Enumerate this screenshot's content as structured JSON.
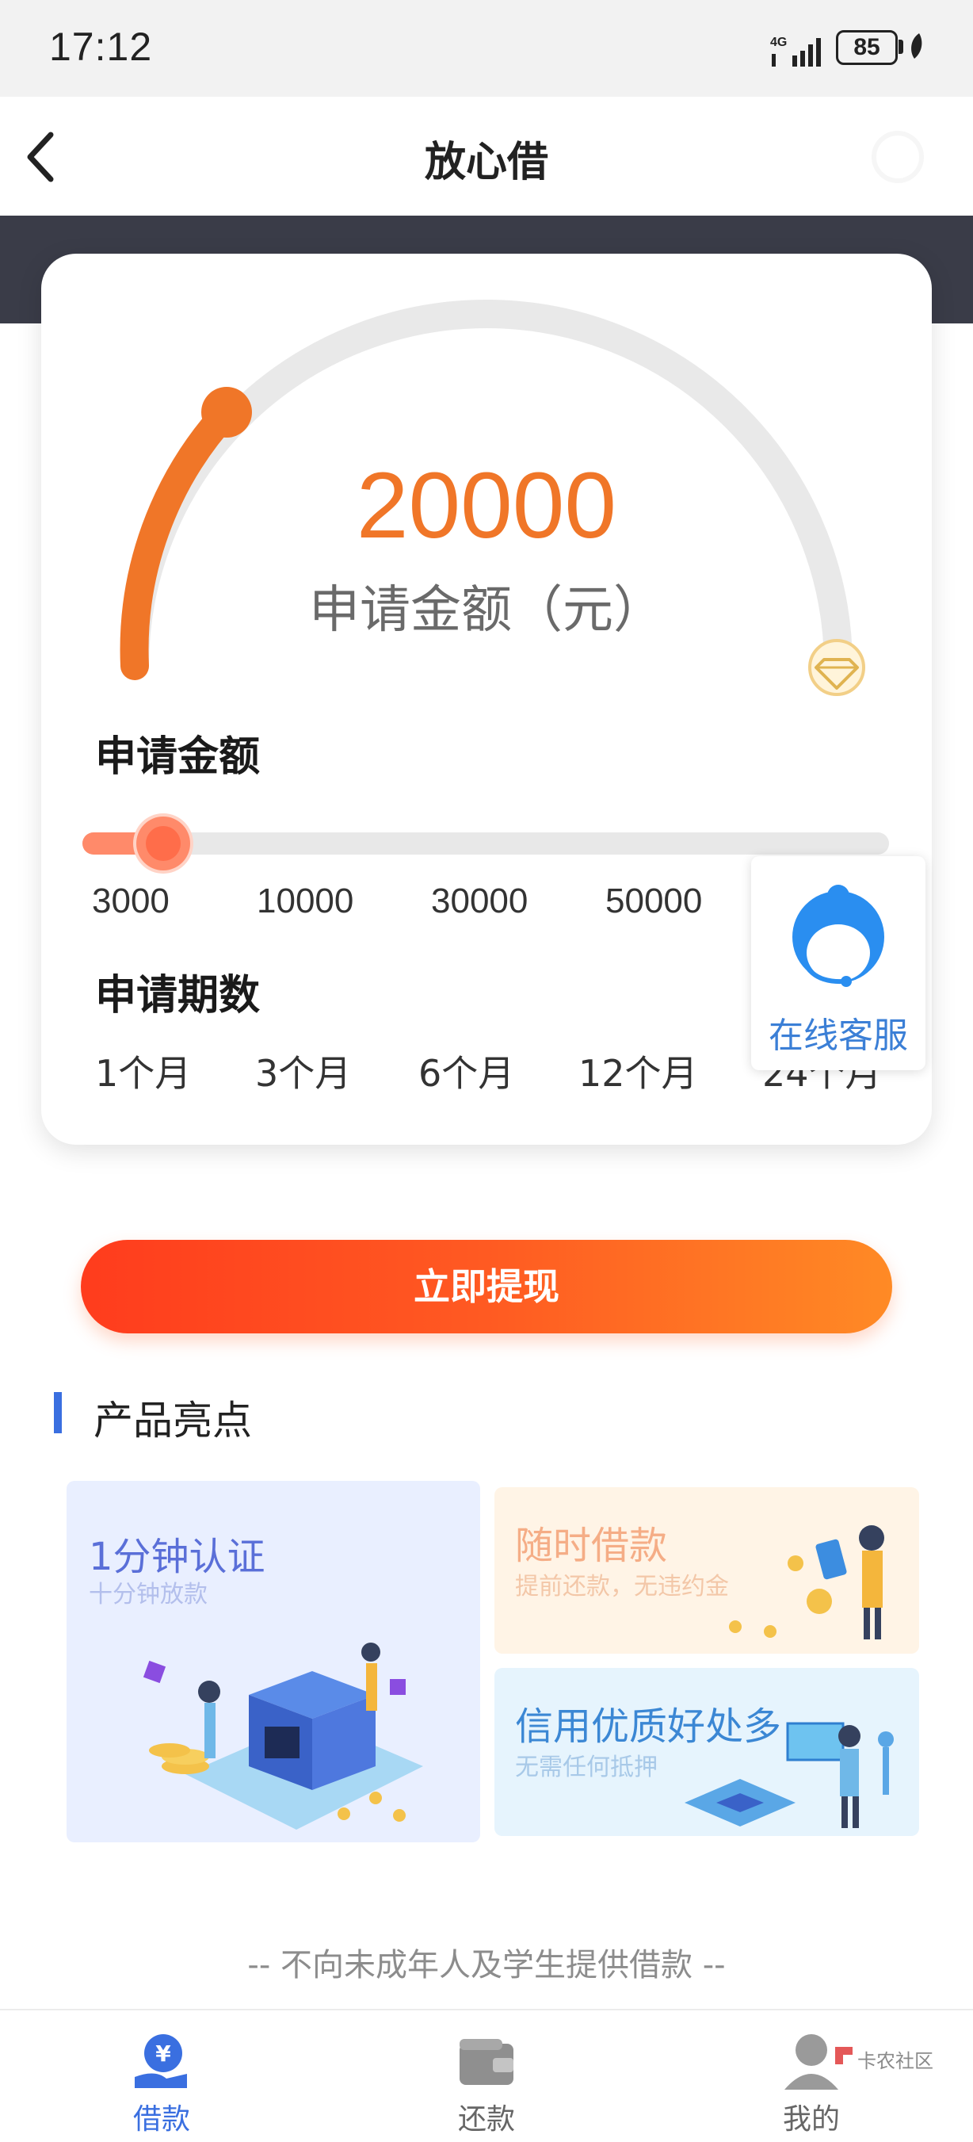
{
  "status_bar": {
    "time": "17:12",
    "network": "4G",
    "battery": "85"
  },
  "header": {
    "title": "放心借"
  },
  "loan": {
    "amount": "20000",
    "amount_caption": "申请金额（元）",
    "amount_section_title": "申请金额",
    "amount_ticks": [
      "3000",
      "10000",
      "30000",
      "50000"
    ],
    "slider_fraction": 0.1,
    "period_section_title": "申请期数",
    "periods": [
      "1个月",
      "3个月",
      "6个月",
      "12个月",
      "24个月"
    ]
  },
  "service": {
    "label": "在线客服"
  },
  "actions": {
    "withdraw_label": "立即提现"
  },
  "highlights": {
    "title": "产品亮点",
    "cards": [
      {
        "title": "1分钟认证",
        "subtitle": "十分钟放款"
      },
      {
        "title": "随时借款",
        "subtitle": "提前还款，无违约金"
      },
      {
        "title": "信用优质好处多",
        "subtitle": "无需任何抵押"
      }
    ]
  },
  "disclaimer": "-- 不向未成年人及学生提供借款 --",
  "tabbar": {
    "items": [
      {
        "label": "借款",
        "icon": "borrow-icon",
        "active": true
      },
      {
        "label": "还款",
        "icon": "wallet-icon",
        "active": false
      },
      {
        "label": "我的",
        "icon": "profile-icon",
        "active": false
      }
    ]
  },
  "watermark": "卡农社区",
  "colors": {
    "accent_orange": "#f07628",
    "primary_blue": "#3a6fe0",
    "button_red": "#ff3c1d"
  }
}
